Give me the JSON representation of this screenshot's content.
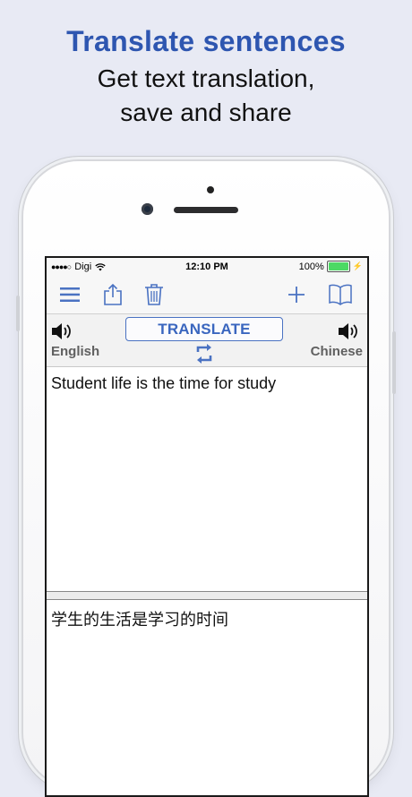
{
  "promo": {
    "headline": "Translate sentences",
    "subline_1": "Get text translation,",
    "subline_2": "save and share"
  },
  "status_bar": {
    "carrier": "Digi",
    "time": "12:10 PM",
    "battery": "100%"
  },
  "toolbar": {
    "icons": [
      "menu-icon",
      "share-icon",
      "trash-icon",
      "plus-icon",
      "book-icon"
    ]
  },
  "translator": {
    "translate_label": "TRANSLATE",
    "source_language": "English",
    "target_language": "Chinese",
    "source_text": "Student life is the time for study",
    "translated_text": "学生的生活是学习的时间"
  },
  "colors": {
    "accent": "#3a66bf",
    "headline": "#2e56b0",
    "background": "#e8eaf4"
  }
}
